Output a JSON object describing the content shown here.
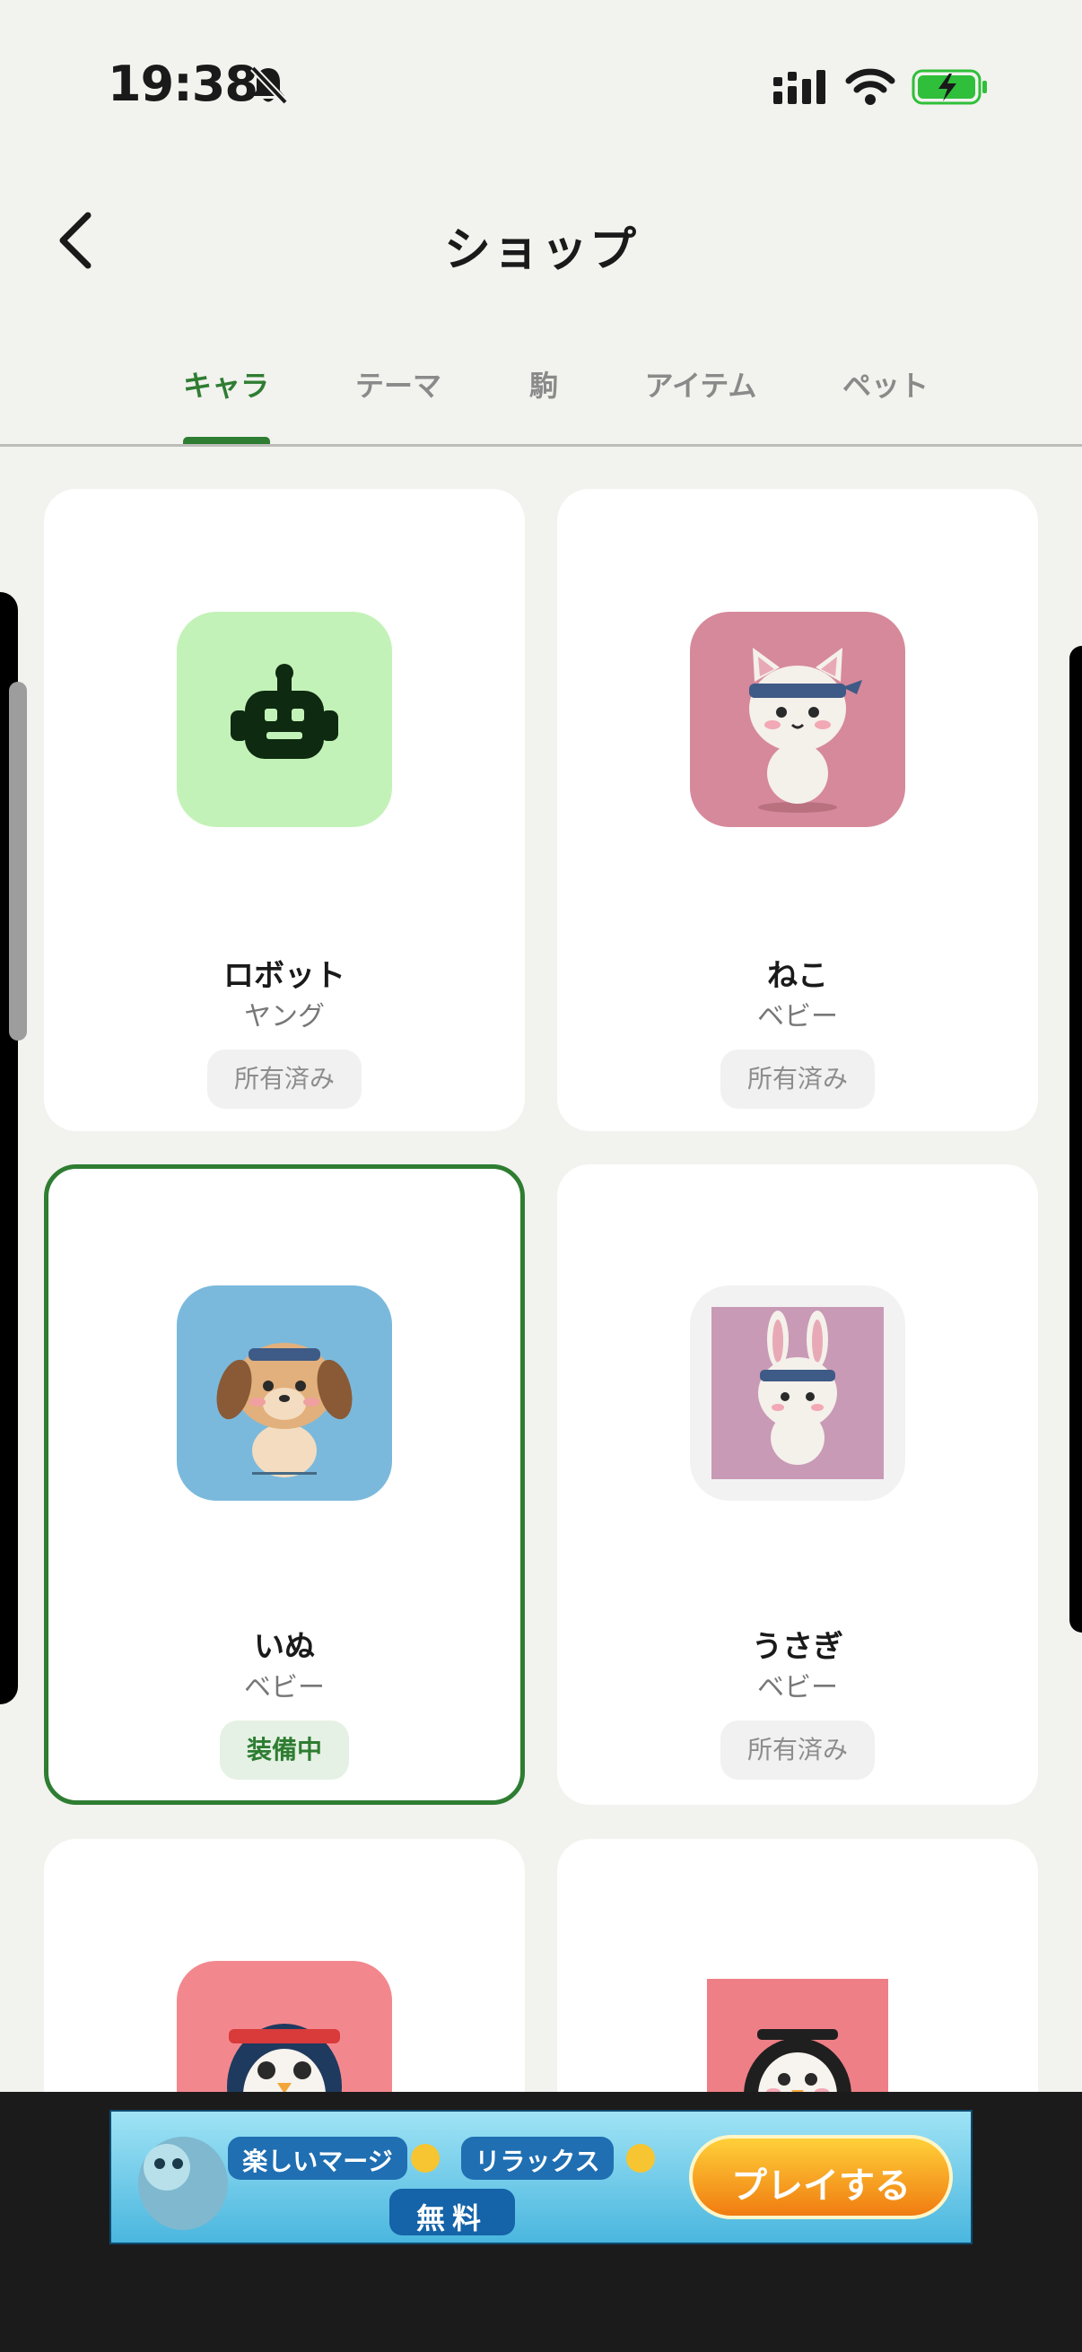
{
  "status_bar": {
    "time": "19:38"
  },
  "header": {
    "title": "ショップ"
  },
  "tabs": [
    {
      "label": "キャラ",
      "active": true
    },
    {
      "label": "テーマ",
      "active": false
    },
    {
      "label": "駒",
      "active": false
    },
    {
      "label": "アイテム",
      "active": false
    },
    {
      "label": "ペット",
      "active": false
    }
  ],
  "cards": [
    {
      "name": "ロボット",
      "rank": "ヤング",
      "status": "所有済み",
      "icon": "robot-icon",
      "bg": "#c3f2b8"
    },
    {
      "name": "ねこ",
      "rank": "ベビー",
      "status": "所有済み",
      "icon": "cat-icon",
      "bg": "#d6899a"
    },
    {
      "name": "いぬ",
      "rank": "ベビー",
      "status": "装備中",
      "icon": "dog-icon",
      "bg": "#7ab9dc",
      "selected": true
    },
    {
      "name": "うさぎ",
      "rank": "ベビー",
      "status": "所有済み",
      "icon": "rabbit-icon",
      "bg": "#c89ab6"
    },
    {
      "name": "",
      "rank": "",
      "status": "",
      "icon": "penguin-icon",
      "bg": "#f2888e"
    },
    {
      "name": "",
      "rank": "",
      "status": "",
      "icon": "bird-icon",
      "bg": "#ef7f86"
    }
  ],
  "ad": {
    "text_1": "楽しいマージ",
    "text_2": "リラックス",
    "text_3": "無料",
    "button": "プレイする"
  },
  "colors": {
    "accent": "#2e7d32",
    "background": "#f2f2ee"
  }
}
